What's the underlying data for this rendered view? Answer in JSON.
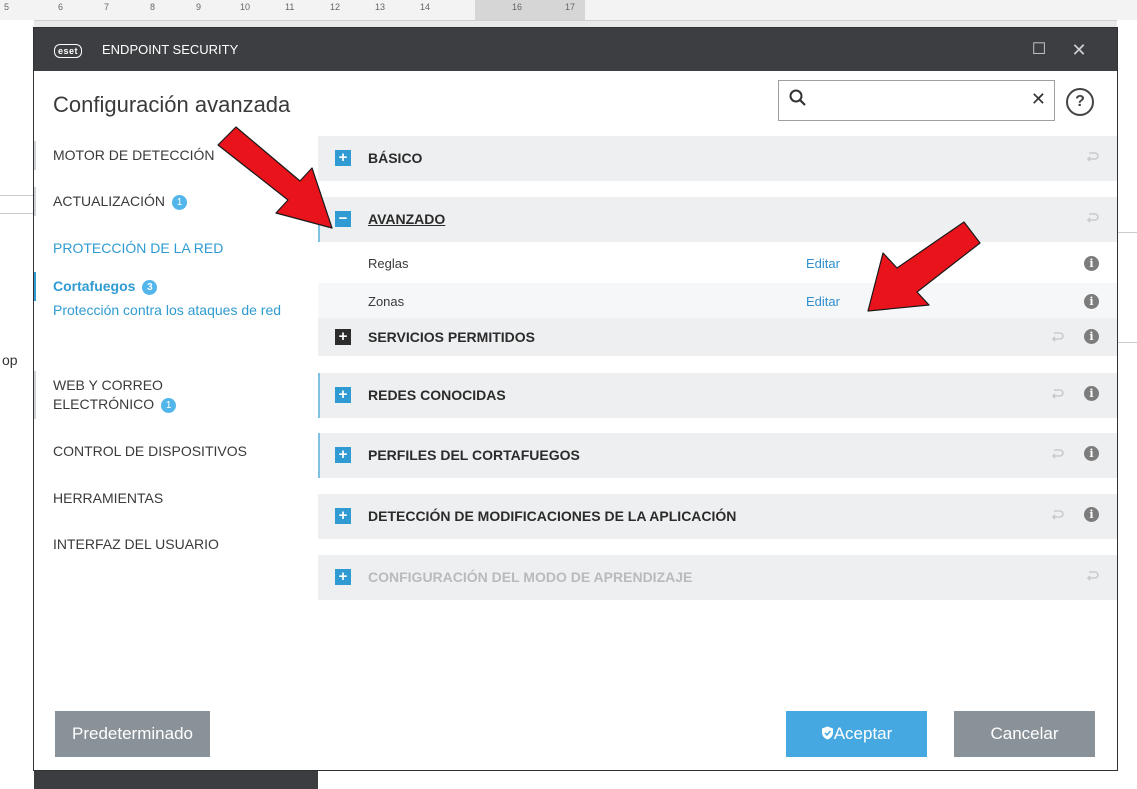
{
  "background": {
    "ruler_numbers": [
      "5",
      "6",
      "7",
      "8",
      "9",
      "10",
      "11",
      "12",
      "13",
      "14",
      "16",
      "17"
    ],
    "left_text": "op"
  },
  "window": {
    "brand_logo": "eset",
    "app_title": "ENDPOINT SECURITY",
    "heading": "Configuración avanzada",
    "search": {
      "value": "",
      "placeholder": ""
    },
    "help_label": "?"
  },
  "sidebar": {
    "items": [
      {
        "label": "MOTOR DE DETECCIÓN"
      },
      {
        "label": "ACTUALIZACIÓN",
        "badge": "1"
      },
      {
        "label": "PROTECCIÓN DE LA RED"
      },
      {
        "label": "Cortafuegos",
        "badge": "3"
      },
      {
        "label": "Protección contra los ataques de red"
      },
      {
        "label": "WEB Y CORREO ELECTRÓNICO",
        "badge": "1"
      },
      {
        "label": "CONTROL DE DISPOSITIVOS"
      },
      {
        "label": "HERRAMIENTAS"
      },
      {
        "label": "INTERFAZ DEL USUARIO"
      }
    ]
  },
  "sections": {
    "basico": {
      "label": "BÁSICO",
      "toggle": "+"
    },
    "avanzado": {
      "label": "AVANZADO",
      "toggle": "−"
    },
    "reglas": {
      "label": "Reglas",
      "action": "Editar"
    },
    "zonas": {
      "label": "Zonas",
      "action": "Editar"
    },
    "servicios": {
      "label": "SERVICIOS PERMITIDOS",
      "toggle": "+"
    },
    "redes": {
      "label": "REDES CONOCIDAS",
      "toggle": "+"
    },
    "perfiles": {
      "label": "PERFILES DEL CORTAFUEGOS",
      "toggle": "+"
    },
    "deteccion": {
      "label": "DETECCIÓN DE MODIFICACIONES DE LA APLICACIÓN",
      "toggle": "+"
    },
    "aprendizaje": {
      "label": "CONFIGURACIÓN DEL MODO DE APRENDIZAJE",
      "toggle": "+"
    }
  },
  "footer": {
    "default_label": "Predeterminado",
    "accept_label": "Aceptar",
    "cancel_label": "Cancelar"
  },
  "colors": {
    "accent": "#2f9bd2",
    "titlebar": "#3c3e42",
    "arrow": "#e8131b"
  }
}
